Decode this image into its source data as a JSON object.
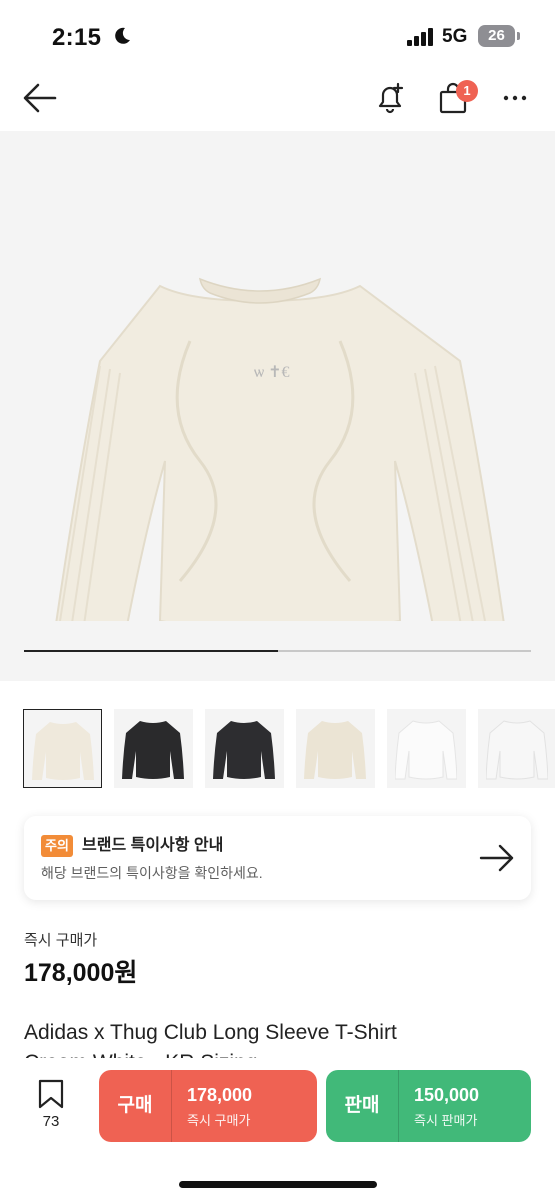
{
  "status_bar": {
    "time": "2:15",
    "network": "5G",
    "battery": "26"
  },
  "nav": {
    "cart_count": "1"
  },
  "gallery": {
    "progress": 0.5,
    "thumbnail_count": 6,
    "selected_index": 0
  },
  "notice": {
    "badge": "주의",
    "title": "브랜드 특이사항 안내",
    "subtitle": "해당 브랜드의 특이사항을 확인하세요."
  },
  "price": {
    "label": "즉시 구매가",
    "value": "178,000원"
  },
  "product": {
    "title_line1": "Adidas x Thug Club Long Sleeve T-Shirt",
    "title_line2": "Cream White - KR Sizing"
  },
  "bottom_bar": {
    "wish_count": "73",
    "buy": {
      "label": "구매",
      "price": "178,000",
      "sub": "즉시 구매가"
    },
    "sell": {
      "label": "판매",
      "price": "150,000",
      "sub": "즉시 판매가"
    }
  },
  "colors": {
    "buy": "#ef6253",
    "sell": "#41b979",
    "badge_orange": "#f28c38",
    "cart_badge": "#ef6253"
  },
  "icons": [
    "moon-icon",
    "signal-icon",
    "back-arrow-icon",
    "bell-plus-icon",
    "shopping-bag-icon",
    "more-icon",
    "arrow-right-icon",
    "bookmark-icon"
  ]
}
